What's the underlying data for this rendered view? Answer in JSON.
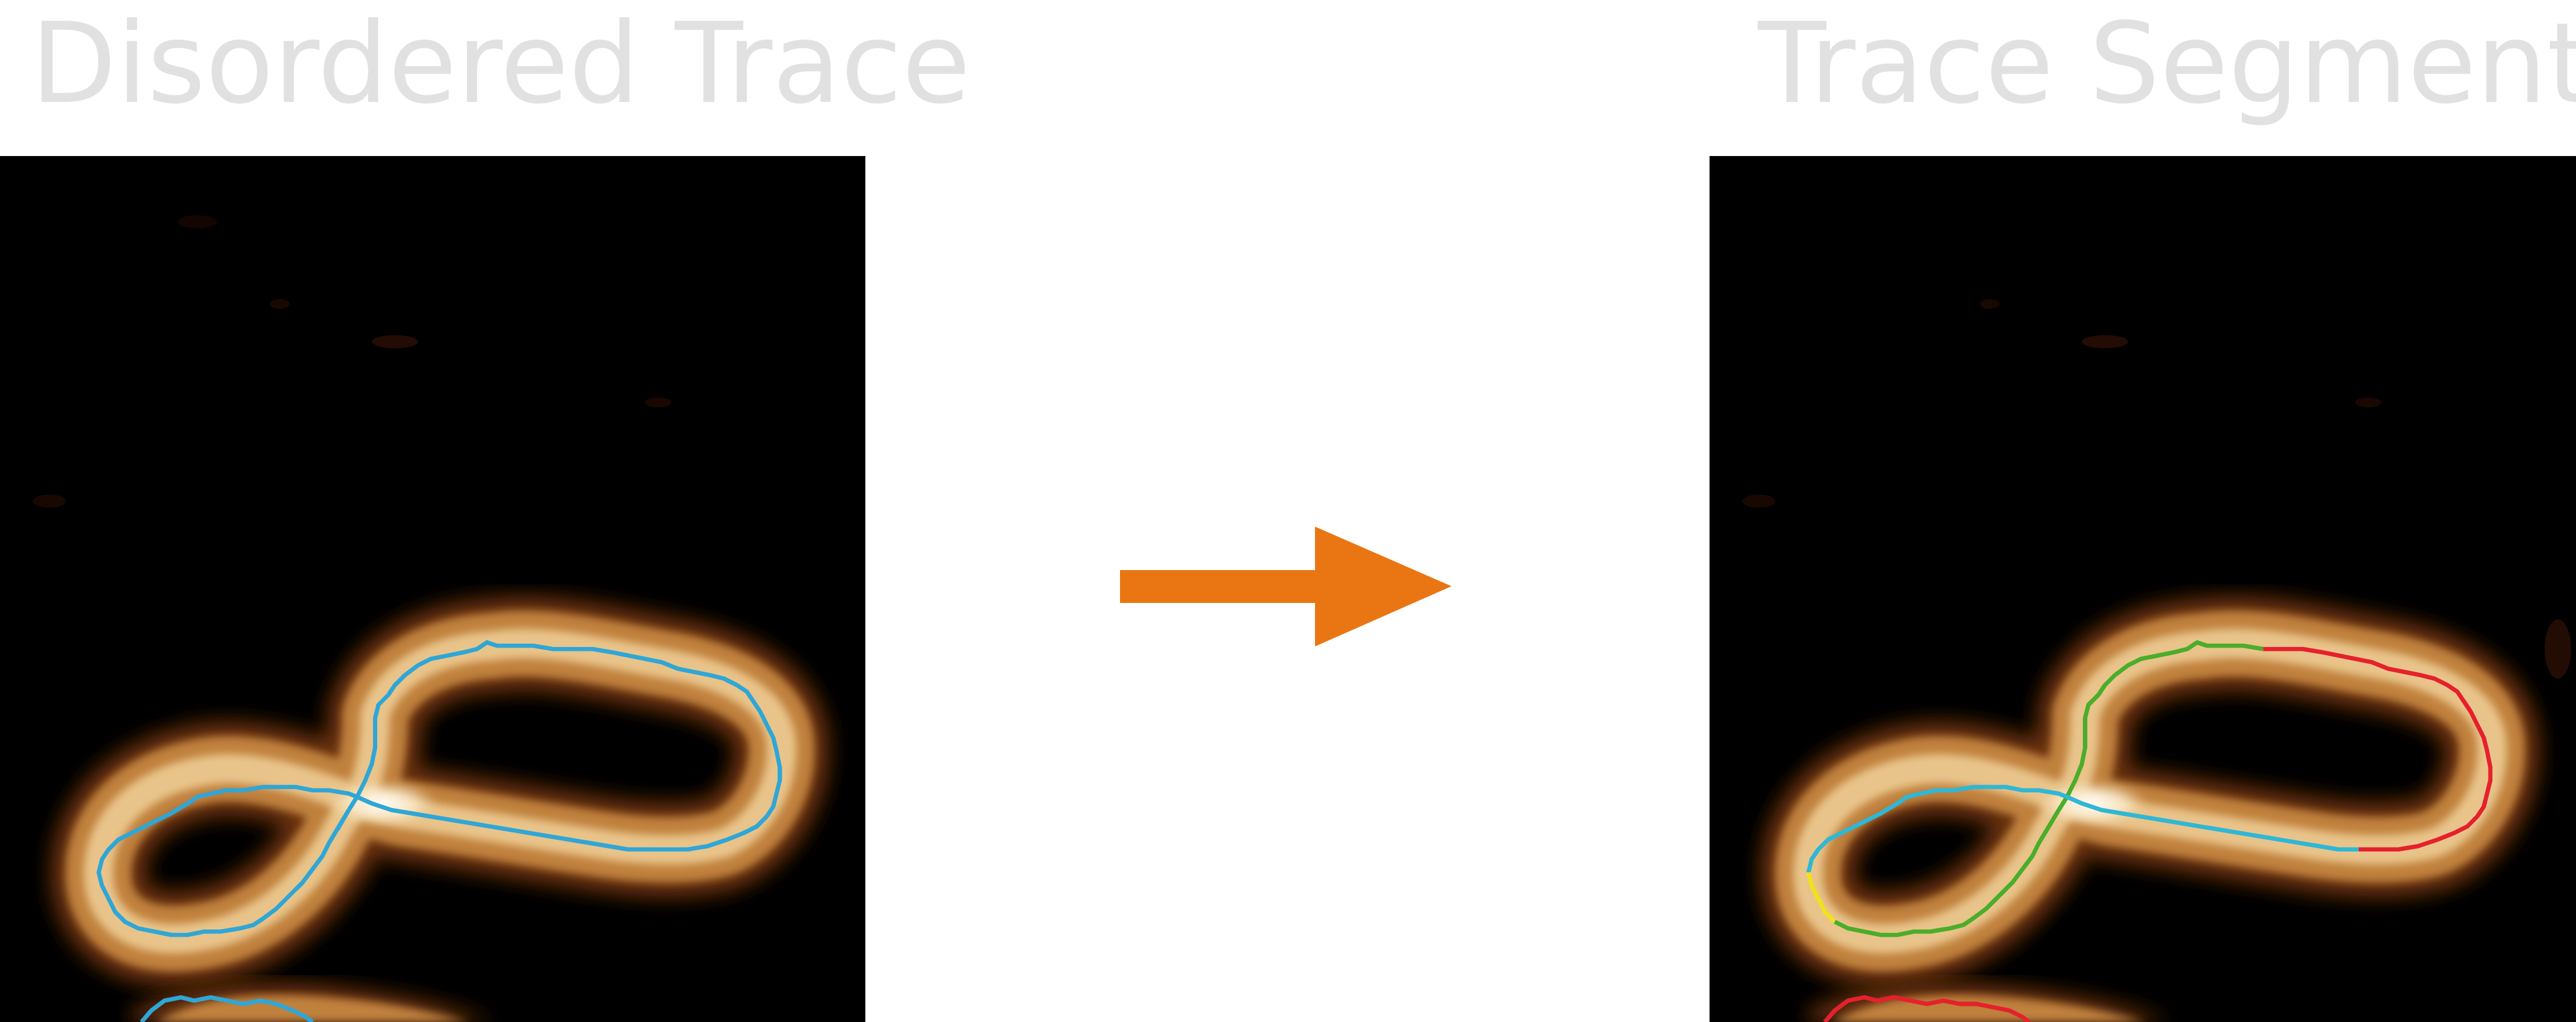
{
  "left_panel": {
    "title": "Disordered Trace",
    "trace_color": "#2fa6d6"
  },
  "right_panel": {
    "title": "Trace Segments",
    "segment_colors": {
      "cyan": "#2fb7d6",
      "green": "#4bad2a",
      "red": "#e5212c",
      "yellow": "#f2e21a"
    }
  },
  "arrow": {
    "icon": "right-arrow-icon",
    "color": "#e97613"
  },
  "image_colors": {
    "background": "#000000",
    "molecule_edge": "#8a4a12",
    "molecule_body": "#d9a35a",
    "molecule_peak": "#ffffff"
  }
}
